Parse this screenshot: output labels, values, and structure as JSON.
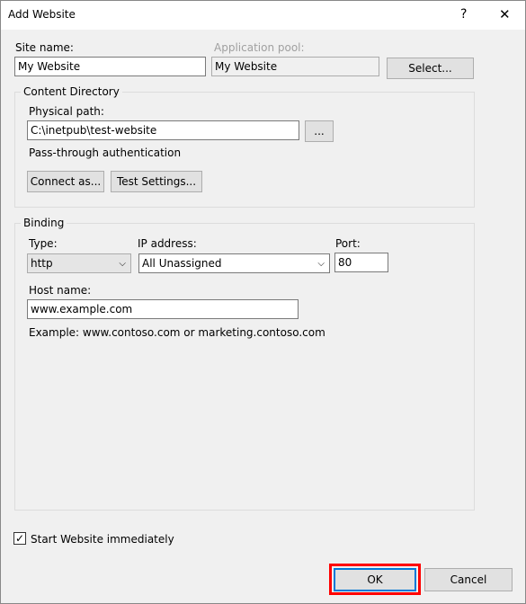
{
  "window": {
    "title": "Add Website",
    "help": "?",
    "close": "✕"
  },
  "site_name": {
    "label": "Site name:",
    "value": "My Website"
  },
  "app_pool": {
    "label": "Application pool:",
    "value": "My Website",
    "select_label": "Select..."
  },
  "content": {
    "group_label": "Content Directory",
    "path_label": "Physical path:",
    "path_value": "C:\\inetpub\\test-website",
    "browse_label": "...",
    "auth_text": "Pass-through authentication",
    "connect_label": "Connect as...",
    "test_label": "Test Settings..."
  },
  "binding": {
    "group_label": "Binding",
    "type_label": "Type:",
    "type_value": "http",
    "ip_label": "IP address:",
    "ip_value": "All Unassigned",
    "port_label": "Port:",
    "port_value": "80",
    "host_label": "Host name:",
    "host_value": "www.example.com",
    "example": "Example: www.contoso.com or marketing.contoso.com"
  },
  "start": {
    "label": "Start Website immediately",
    "checked": true
  },
  "footer": {
    "ok": "OK",
    "cancel": "Cancel"
  },
  "highlight_color": "#ff0000"
}
